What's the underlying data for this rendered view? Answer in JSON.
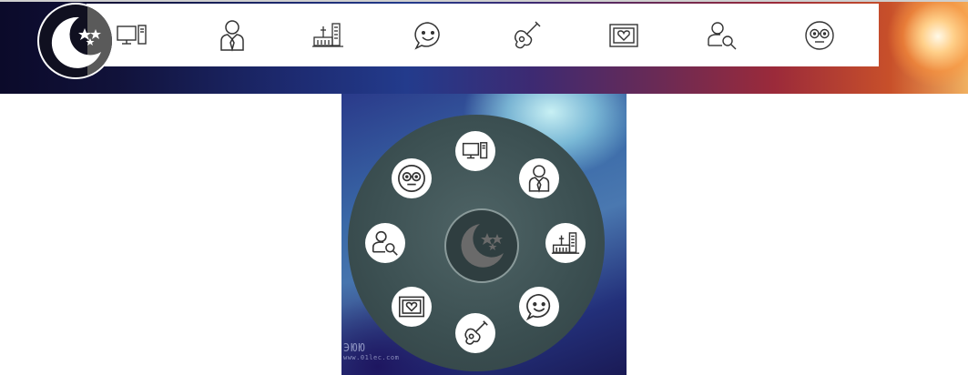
{
  "nav": {
    "items": [
      {
        "id": "computer",
        "icon": "computer-icon"
      },
      {
        "id": "businessman",
        "icon": "businessman-icon"
      },
      {
        "id": "factory",
        "icon": "factory-icon"
      },
      {
        "id": "chat",
        "icon": "smiley-chat-icon"
      },
      {
        "id": "guitar",
        "icon": "guitar-icon"
      },
      {
        "id": "picture",
        "icon": "heart-picture-icon"
      },
      {
        "id": "user-search",
        "icon": "user-search-icon"
      },
      {
        "id": "glasses",
        "icon": "glasses-face-icon"
      }
    ]
  },
  "logo": {
    "icon": "moon-stars-icon"
  },
  "wheel": {
    "center_icon": "moon-stars-icon"
  },
  "watermark": {
    "text": "ЭЮЮ",
    "url": "www.01lec.com"
  },
  "colors": {
    "nav_bg": "#ffffff",
    "icon_stroke": "#333333",
    "wheel_bg": "#3c5052"
  }
}
